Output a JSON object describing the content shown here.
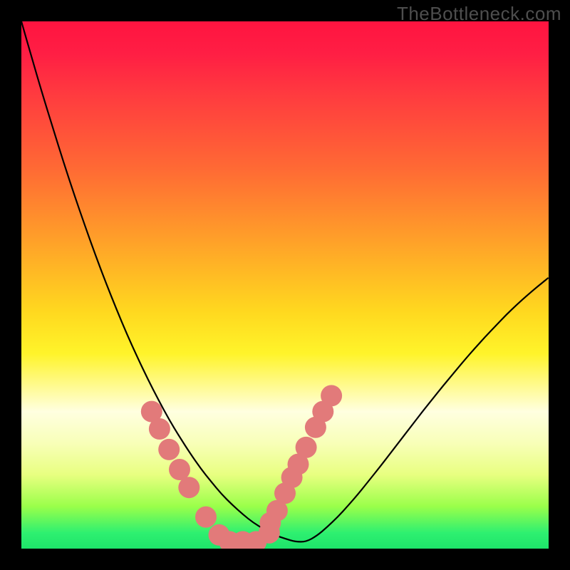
{
  "watermark": "TheBottleneck.com",
  "chart_data": {
    "type": "line",
    "title": "",
    "xlabel": "",
    "ylabel": "",
    "x": [
      0.0,
      0.02,
      0.04,
      0.06,
      0.08,
      0.1,
      0.12,
      0.14,
      0.16,
      0.18,
      0.2,
      0.22,
      0.24,
      0.26,
      0.28,
      0.3,
      0.32,
      0.34,
      0.36,
      0.38,
      0.4,
      0.42,
      0.44,
      0.46,
      0.48,
      0.5,
      0.52,
      0.54,
      0.56,
      0.58,
      0.6,
      0.62,
      0.64,
      0.66,
      0.68,
      0.7,
      0.72,
      0.74,
      0.76,
      0.78,
      0.8,
      0.82,
      0.84,
      0.86,
      0.88,
      0.9,
      0.92,
      0.94,
      0.96,
      0.98,
      1.0
    ],
    "values": [
      1.0,
      0.93,
      0.862,
      0.797,
      0.733,
      0.672,
      0.614,
      0.558,
      0.505,
      0.455,
      0.407,
      0.363,
      0.321,
      0.282,
      0.245,
      0.212,
      0.181,
      0.152,
      0.127,
      0.103,
      0.083,
      0.065,
      0.049,
      0.037,
      0.026,
      0.019,
      0.013,
      0.013,
      0.024,
      0.041,
      0.06,
      0.082,
      0.105,
      0.13,
      0.155,
      0.181,
      0.207,
      0.233,
      0.259,
      0.284,
      0.309,
      0.333,
      0.357,
      0.38,
      0.402,
      0.423,
      0.444,
      0.463,
      0.481,
      0.498,
      0.514
    ],
    "xlim": [
      0,
      1
    ],
    "ylim": [
      0,
      1
    ],
    "background_gradient": {
      "orientation": "vertical",
      "stops": [
        {
          "pos": 0.0,
          "color": "#ff1440"
        },
        {
          "pos": 0.28,
          "color": "#ff6a34"
        },
        {
          "pos": 0.55,
          "color": "#ffd81f"
        },
        {
          "pos": 0.74,
          "color": "#ffffe0"
        },
        {
          "pos": 0.92,
          "color": "#9aff4a"
        },
        {
          "pos": 1.0,
          "color": "#1ee46a"
        }
      ]
    },
    "markers": {
      "color": "#e27a7a",
      "radius_px": 15,
      "points": [
        {
          "x": 0.247,
          "y": 0.26
        },
        {
          "x": 0.262,
          "y": 0.227
        },
        {
          "x": 0.28,
          "y": 0.188
        },
        {
          "x": 0.3,
          "y": 0.15
        },
        {
          "x": 0.318,
          "y": 0.116
        },
        {
          "x": 0.35,
          "y": 0.06
        },
        {
          "x": 0.375,
          "y": 0.026
        },
        {
          "x": 0.395,
          "y": 0.013
        },
        {
          "x": 0.42,
          "y": 0.013
        },
        {
          "x": 0.445,
          "y": 0.013
        },
        {
          "x": 0.47,
          "y": 0.03
        },
        {
          "x": 0.472,
          "y": 0.049
        },
        {
          "x": 0.485,
          "y": 0.072
        },
        {
          "x": 0.5,
          "y": 0.105
        },
        {
          "x": 0.513,
          "y": 0.135
        },
        {
          "x": 0.525,
          "y": 0.16
        },
        {
          "x": 0.54,
          "y": 0.192
        },
        {
          "x": 0.558,
          "y": 0.23
        },
        {
          "x": 0.572,
          "y": 0.26
        },
        {
          "x": 0.588,
          "y": 0.29
        }
      ]
    }
  }
}
